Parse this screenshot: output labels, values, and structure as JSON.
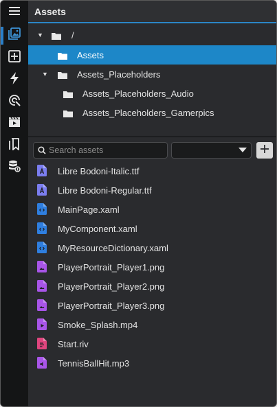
{
  "header": {
    "title": "Assets"
  },
  "tree": [
    {
      "label": "/",
      "caret": "▼"
    },
    {
      "label": "Assets",
      "caret": ""
    },
    {
      "label": "Assets_Placeholders",
      "caret": "▼"
    },
    {
      "label": "Assets_Placeholders_Audio",
      "caret": ""
    },
    {
      "label": "Assets_Placeholders_Gamerpics",
      "caret": ""
    }
  ],
  "search": {
    "placeholder": "Search assets",
    "value": ""
  },
  "filter": {
    "selected": ""
  },
  "add_button": {
    "label": "+"
  },
  "files": [
    {
      "name": "Libre Bodoni-Italic.ttf",
      "icon": "font-file-icon",
      "color": "#7b7ef0"
    },
    {
      "name": "Libre Bodoni-Regular.ttf",
      "icon": "font-file-icon",
      "color": "#7b7ef0"
    },
    {
      "name": "MainPage.xaml",
      "icon": "code-file-icon",
      "color": "#2f7fe0"
    },
    {
      "name": "MyComponent.xaml",
      "icon": "code-file-icon",
      "color": "#2f7fe0"
    },
    {
      "name": "MyResourceDictionary.xaml",
      "icon": "code-file-icon",
      "color": "#2f7fe0"
    },
    {
      "name": "PlayerPortrait_Player1.png",
      "icon": "image-file-icon",
      "color": "#a855e8"
    },
    {
      "name": "PlayerPortrait_Player2.png",
      "icon": "image-file-icon",
      "color": "#a855e8"
    },
    {
      "name": "PlayerPortrait_Player3.png",
      "icon": "image-file-icon",
      "color": "#a855e8"
    },
    {
      "name": "Smoke_Splash.mp4",
      "icon": "video-file-icon",
      "color": "#a855e8"
    },
    {
      "name": "Start.riv",
      "icon": "rive-file-icon",
      "color": "#e0457e"
    },
    {
      "name": "TennisBallHit.mp3",
      "icon": "audio-file-icon",
      "color": "#a855e8"
    }
  ],
  "sidebar_icons": [
    "menu-icon",
    "assets-icon",
    "add-box-icon",
    "lightning-icon",
    "themes-icon",
    "media-icon",
    "bookmarks-icon",
    "data-icon"
  ],
  "colors": {
    "accent": "#1d87c8",
    "background": "#2a2b2e",
    "sidebar": "#141516"
  }
}
